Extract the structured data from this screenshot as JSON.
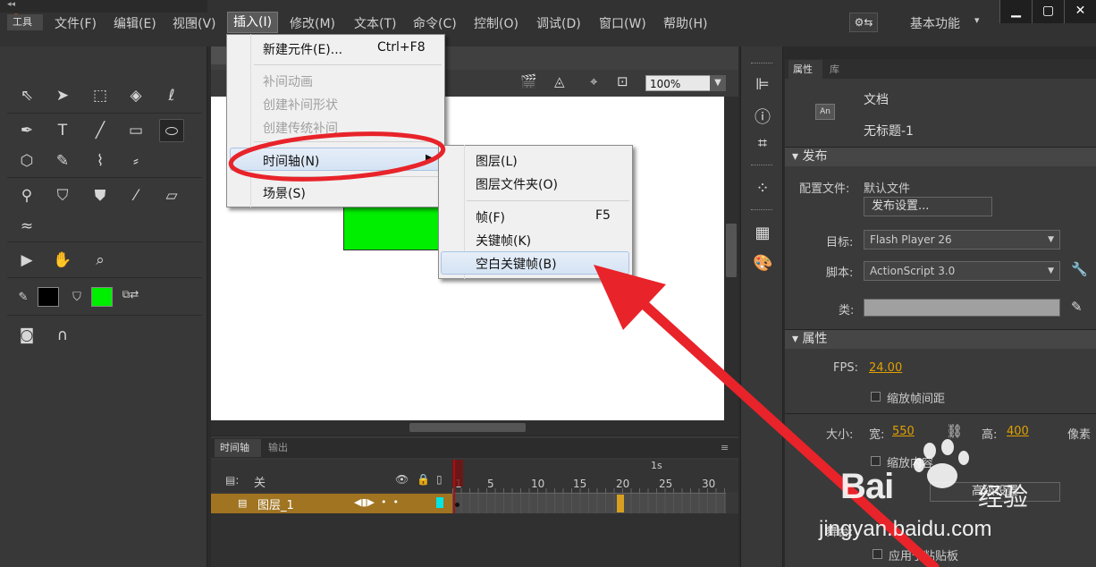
{
  "app": {
    "logo": "An"
  },
  "menubar": {
    "items": [
      {
        "label": "文件(F)"
      },
      {
        "label": "编辑(E)"
      },
      {
        "label": "视图(V)"
      },
      {
        "label": "插入(I)"
      },
      {
        "label": "修改(M)"
      },
      {
        "label": "文本(T)"
      },
      {
        "label": "命令(C)"
      },
      {
        "label": "控制(O)"
      },
      {
        "label": "调试(D)"
      },
      {
        "label": "窗口(W)"
      },
      {
        "label": "帮助(H)"
      }
    ],
    "active_index": 3,
    "workspace": "基本功能"
  },
  "tools_panel": {
    "tab": "工具"
  },
  "stage": {
    "zoom": "100%",
    "shape_color": "#00ee00"
  },
  "insert_menu": {
    "items": [
      {
        "label": "新建元件(E)...",
        "shortcut": "Ctrl+F8",
        "enabled": true
      },
      {
        "label": "补间动画",
        "enabled": false
      },
      {
        "label": "创建补间形状",
        "enabled": false
      },
      {
        "label": "创建传统补间",
        "enabled": false
      },
      {
        "label": "时间轴(N)",
        "enabled": true,
        "submenu": true,
        "highlighted": true
      },
      {
        "label": "场景(S)",
        "enabled": true
      }
    ]
  },
  "timeline_submenu": {
    "items": [
      {
        "label": "图层(L)"
      },
      {
        "label": "图层文件夹(O)"
      },
      {
        "label": "帧(F)",
        "shortcut": "F5"
      },
      {
        "label": "关键帧(K)"
      },
      {
        "label": "空白关键帧(B)",
        "highlighted": true
      }
    ]
  },
  "timeline": {
    "tabs": [
      "时间轴",
      "输出"
    ],
    "header_label": "关",
    "seconds_label": "1s",
    "frame_numbers": [
      "1",
      "5",
      "10",
      "15",
      "20",
      "25",
      "30"
    ],
    "layer": {
      "name": "图层_1",
      "color": "#00e5e5",
      "row_color": "#a07420"
    }
  },
  "properties_panel": {
    "tabs": [
      "属性",
      "库"
    ],
    "doc_type": "文档",
    "doc_name": "无标题-1",
    "doc_icon": "An",
    "publish": {
      "header": "发布",
      "profile_label": "配置文件:",
      "profile_value": "默认文件",
      "settings_button": "发布设置...",
      "target_label": "目标:",
      "target_value": "Flash Player 26",
      "script_label": "脚本:",
      "script_value": "ActionScript 3.0",
      "class_label": "类:"
    },
    "properties": {
      "header": "属性",
      "fps_label": "FPS:",
      "fps_value": "24.00",
      "scale_interval": "缩放帧间距",
      "size_label": "大小:",
      "width_label": "宽:",
      "width_value": "550",
      "height_label": "高:",
      "height_value": "400",
      "unit_label": "像素",
      "scale_content": "缩放内容",
      "advanced_btn": "高级设置",
      "stage_label": "舞台:",
      "apply_paste": "应用于粘贴板"
    }
  },
  "annotations": {
    "color": "#e8232a"
  },
  "watermark": {
    "logo": "Bai",
    "logo_suffix": "经验",
    "url": "jingyan.baidu.com"
  }
}
